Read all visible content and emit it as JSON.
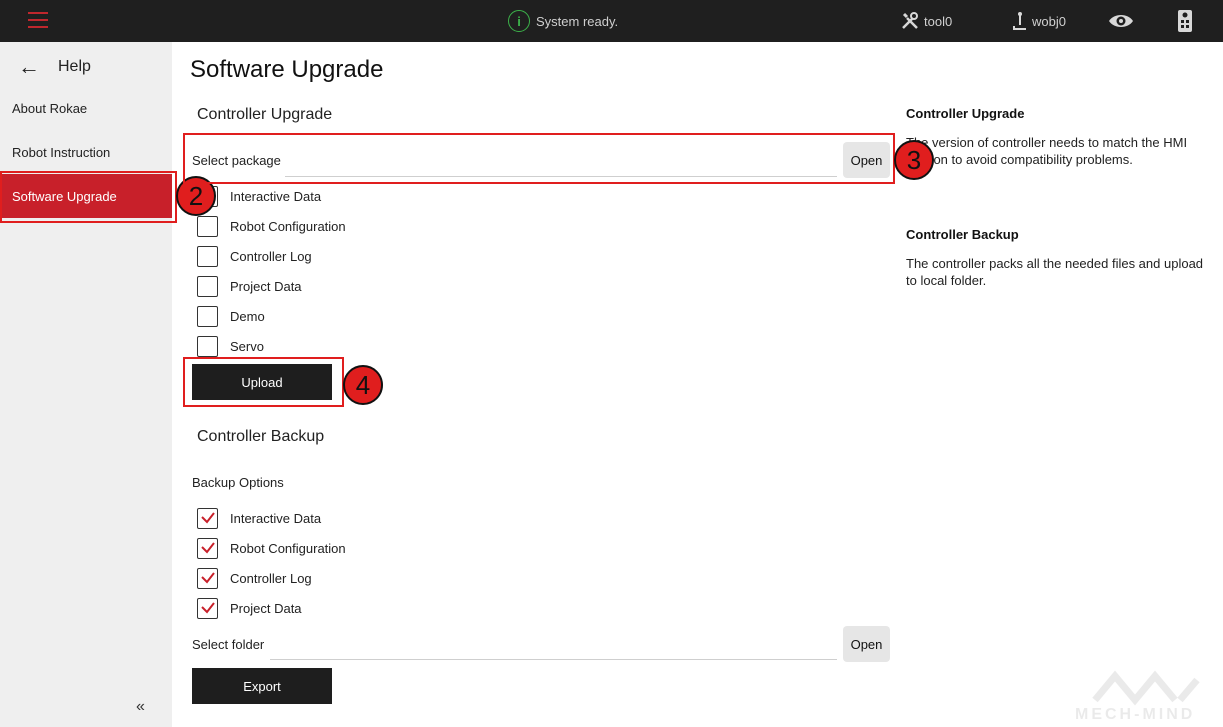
{
  "topbar": {
    "status_text": "System ready.",
    "tool_label": "tool0",
    "wobj_label": "wobj0"
  },
  "sidebar": {
    "header": "Help",
    "items": [
      {
        "label": "About Rokae"
      },
      {
        "label": "Robot Instruction"
      },
      {
        "label": "Software Upgrade",
        "active": true
      }
    ],
    "collapse_glyph": "«"
  },
  "main": {
    "title": "Software Upgrade",
    "controller_upgrade": {
      "title": "Controller Upgrade",
      "select_label": "Select package",
      "open_label": "Open",
      "options": [
        {
          "label": "Interactive Data",
          "checked": false
        },
        {
          "label": "Robot Configuration",
          "checked": false
        },
        {
          "label": "Controller Log",
          "checked": false
        },
        {
          "label": "Project Data",
          "checked": false
        },
        {
          "label": "Demo",
          "checked": false
        },
        {
          "label": "Servo",
          "checked": false
        }
      ],
      "upload_label": "Upload"
    },
    "controller_backup": {
      "title": "Controller Backup",
      "options_label": "Backup Options",
      "options": [
        {
          "label": "Interactive Data",
          "checked": true
        },
        {
          "label": "Robot Configuration",
          "checked": true
        },
        {
          "label": "Controller Log",
          "checked": true
        },
        {
          "label": "Project Data",
          "checked": true
        }
      ],
      "folder_label": "Select folder",
      "open_label": "Open",
      "export_label": "Export"
    }
  },
  "info": {
    "upgrade_title": "Controller Upgrade",
    "upgrade_text": "The version of controller needs to match the HMI version to avoid compatibility problems.",
    "backup_title": "Controller Backup",
    "backup_text": "The controller packs all the needed files and upload to local folder."
  },
  "annotations": [
    "2",
    "3",
    "4"
  ],
  "watermark": "MECH-MIND",
  "colors": {
    "accent": "#c8202a",
    "annotation": "#e01e1e",
    "topbar": "#1f1f1f",
    "status_ok": "#3cb34a"
  }
}
